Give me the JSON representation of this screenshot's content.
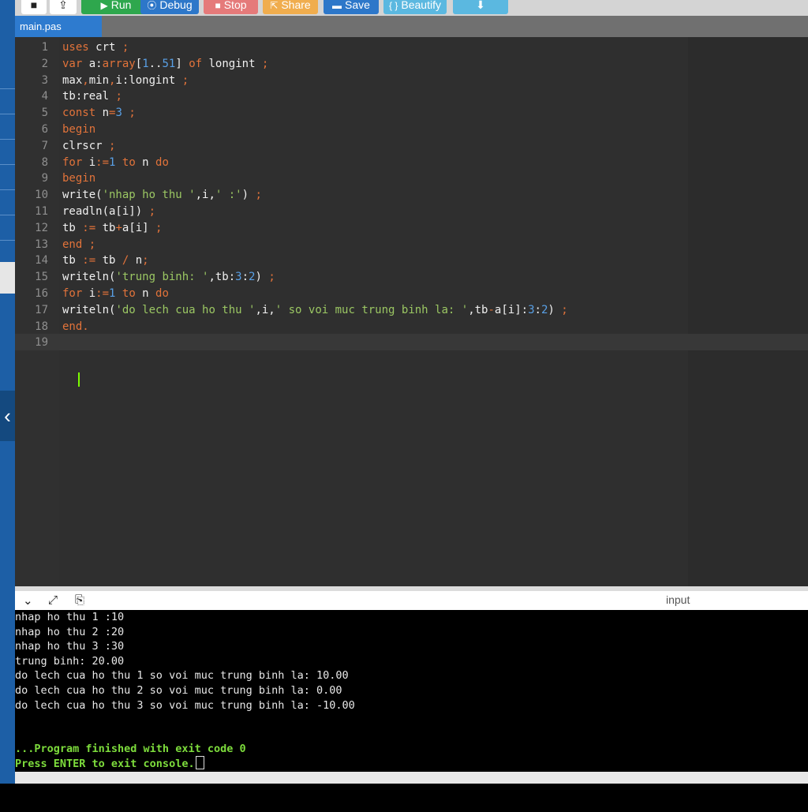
{
  "toolbar": {
    "new_icon": "■",
    "upload_icon": "⇪",
    "run_icon": "▶",
    "run_label": "Run",
    "debug_icon": "⦿",
    "debug_label": "Debug",
    "stop_icon": "■",
    "stop_label": "Stop",
    "share_icon": "⇱",
    "share_label": "Share",
    "save_icon": "▬",
    "save_label": "Save",
    "beautify_icon": "{ }",
    "beautify_label": "Beautify",
    "download_icon": "⬇"
  },
  "tab": {
    "label": "main.pas"
  },
  "sidebar": {
    "collapse_icon": "‹"
  },
  "editor": {
    "line_numbers": [
      "1",
      "2",
      "3",
      "4",
      "5",
      "6",
      "7",
      "8",
      "9",
      "10",
      "11",
      "12",
      "13",
      "14",
      "15",
      "16",
      "17",
      "18",
      "19"
    ],
    "lines": [
      [
        {
          "t": "uses",
          "c": "kw"
        },
        {
          "t": " crt "
        },
        {
          "t": ";",
          "c": "op"
        }
      ],
      [
        {
          "t": "var",
          "c": "kw"
        },
        {
          "t": " a:"
        },
        {
          "t": "array",
          "c": "kw"
        },
        {
          "t": "["
        },
        {
          "t": "1",
          "c": "num"
        },
        {
          "t": ".."
        },
        {
          "t": "51",
          "c": "num"
        },
        {
          "t": "] "
        },
        {
          "t": "of",
          "c": "kw"
        },
        {
          "t": " longint "
        },
        {
          "t": ";",
          "c": "op"
        }
      ],
      [
        {
          "t": "max"
        },
        {
          "t": ",",
          "c": "op"
        },
        {
          "t": "min"
        },
        {
          "t": ",",
          "c": "op"
        },
        {
          "t": "i:longint "
        },
        {
          "t": ";",
          "c": "op"
        }
      ],
      [
        {
          "t": "tb:real "
        },
        {
          "t": ";",
          "c": "op"
        }
      ],
      [
        {
          "t": "const",
          "c": "kw"
        },
        {
          "t": " n"
        },
        {
          "t": "=",
          "c": "op"
        },
        {
          "t": "3",
          "c": "num"
        },
        {
          "t": " "
        },
        {
          "t": ";",
          "c": "op"
        }
      ],
      [
        {
          "t": "begin",
          "c": "kw"
        }
      ],
      [
        {
          "t": "clrscr "
        },
        {
          "t": ";",
          "c": "op"
        }
      ],
      [
        {
          "t": "for",
          "c": "kw"
        },
        {
          "t": " i"
        },
        {
          "t": ":=",
          "c": "op"
        },
        {
          "t": "1",
          "c": "num"
        },
        {
          "t": " "
        },
        {
          "t": "to",
          "c": "kw"
        },
        {
          "t": " n "
        },
        {
          "t": "do",
          "c": "kw"
        }
      ],
      [
        {
          "t": "begin",
          "c": "kw"
        }
      ],
      [
        {
          "t": "write("
        },
        {
          "t": "'nhap ho thu '",
          "c": "str"
        },
        {
          "t": ",i,"
        },
        {
          "t": "' :'",
          "c": "str"
        },
        {
          "t": ") "
        },
        {
          "t": ";",
          "c": "op"
        }
      ],
      [
        {
          "t": "readln(a[i]) "
        },
        {
          "t": ";",
          "c": "op"
        }
      ],
      [
        {
          "t": "tb "
        },
        {
          "t": ":=",
          "c": "op"
        },
        {
          "t": " tb"
        },
        {
          "t": "+",
          "c": "op"
        },
        {
          "t": "a[i] "
        },
        {
          "t": ";",
          "c": "op"
        }
      ],
      [
        {
          "t": "end",
          "c": "kw"
        },
        {
          "t": " "
        },
        {
          "t": ";",
          "c": "op"
        }
      ],
      [
        {
          "t": "tb "
        },
        {
          "t": ":=",
          "c": "op"
        },
        {
          "t": " tb "
        },
        {
          "t": "/",
          "c": "op"
        },
        {
          "t": " n"
        },
        {
          "t": ";",
          "c": "op"
        }
      ],
      [
        {
          "t": "writeln("
        },
        {
          "t": "'trung binh: '",
          "c": "str"
        },
        {
          "t": ",tb:"
        },
        {
          "t": "3",
          "c": "num"
        },
        {
          "t": ":"
        },
        {
          "t": "2",
          "c": "num"
        },
        {
          "t": ") "
        },
        {
          "t": ";",
          "c": "op"
        }
      ],
      [
        {
          "t": "for",
          "c": "kw"
        },
        {
          "t": " i"
        },
        {
          "t": ":=",
          "c": "op"
        },
        {
          "t": "1",
          "c": "num"
        },
        {
          "t": " "
        },
        {
          "t": "to",
          "c": "kw"
        },
        {
          "t": " n "
        },
        {
          "t": "do",
          "c": "kw"
        }
      ],
      [
        {
          "t": "writeln("
        },
        {
          "t": "'do lech cua ho thu '",
          "c": "str"
        },
        {
          "t": ",i,"
        },
        {
          "t": "' so voi muc trung binh la: '",
          "c": "str"
        },
        {
          "t": ",tb"
        },
        {
          "t": "-",
          "c": "op"
        },
        {
          "t": "a[i]:"
        },
        {
          "t": "3",
          "c": "num"
        },
        {
          "t": ":"
        },
        {
          "t": "2",
          "c": "num"
        },
        {
          "t": ") "
        },
        {
          "t": ";",
          "c": "op"
        }
      ],
      [
        {
          "t": "end.",
          "c": "kw"
        }
      ],
      []
    ]
  },
  "console_bar": {
    "collapse_icon": "⌄",
    "expand_icon": "⤢",
    "clear_icon": "⎘",
    "input_label": "input"
  },
  "console": {
    "lines": [
      "nhap ho thu 1 :10",
      "nhap ho thu 2 :20",
      "nhap ho thu 3 :30",
      "trung binh: 20.00",
      "do lech cua ho thu 1 so voi muc trung binh la: 10.00",
      "do lech cua ho thu 2 so voi muc trung binh la: 0.00",
      "do lech cua ho thu 3 so voi muc trung binh la: -10.00"
    ],
    "finished": "...Program finished with exit code 0",
    "press_enter": "Press ENTER to exit console."
  }
}
